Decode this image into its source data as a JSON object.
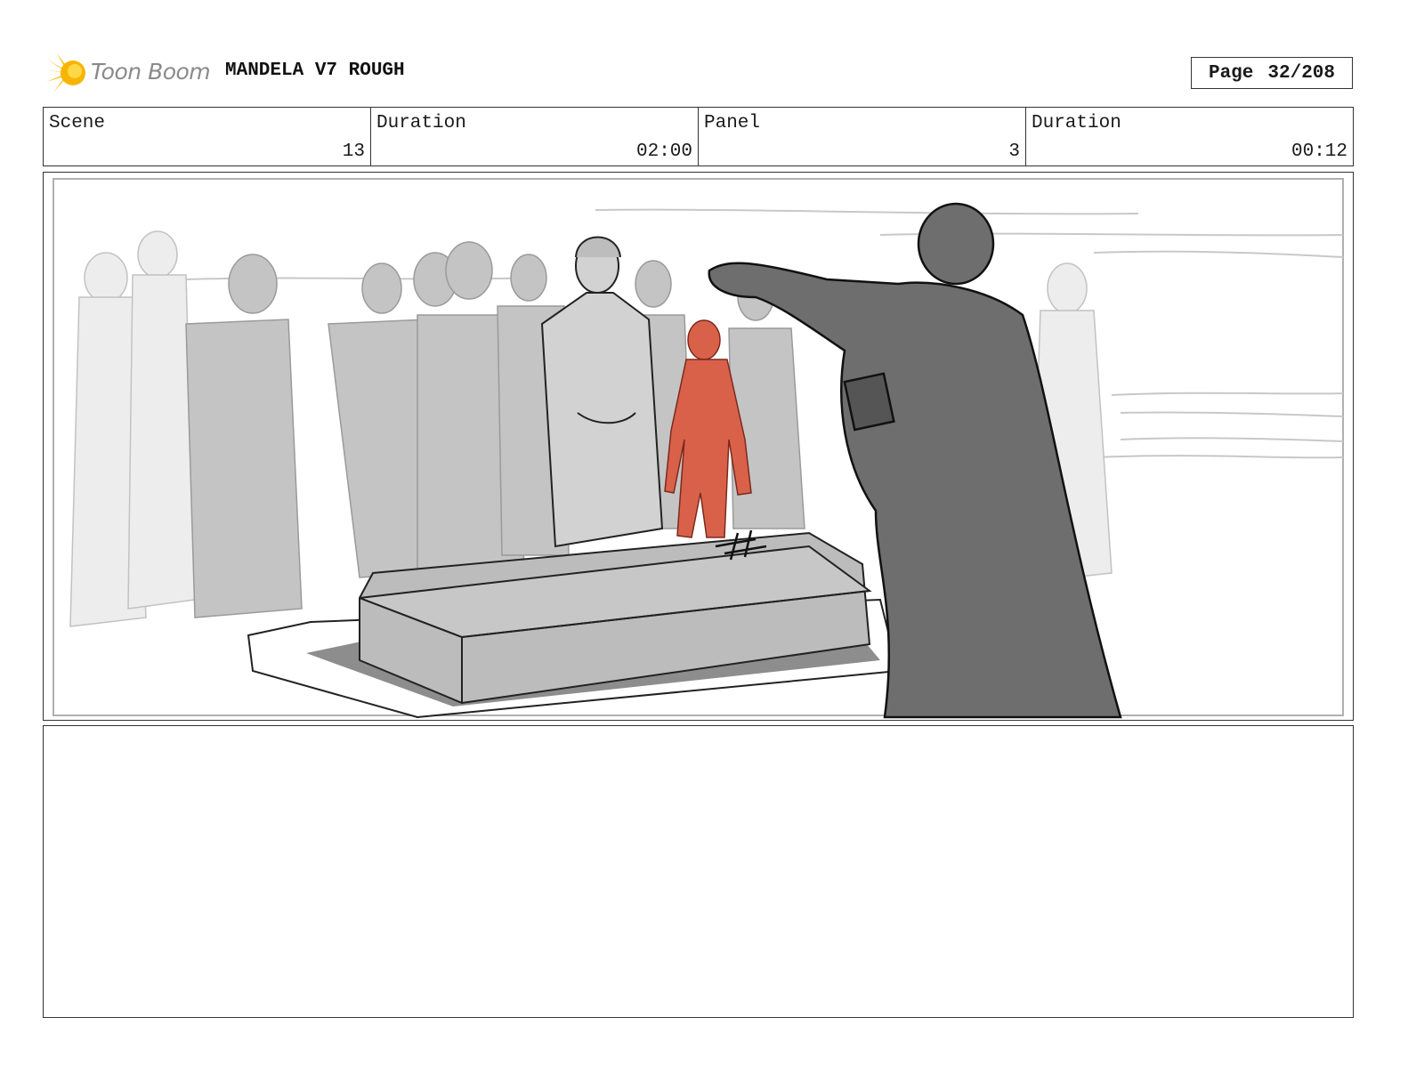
{
  "header": {
    "logo_text": "Toon Boom",
    "logo_icon": "sunburst-logo-icon",
    "project_title": "MANDELA V7 ROUGH",
    "page_label": "Page",
    "page_number": "32/208"
  },
  "info": {
    "scene_label": "Scene",
    "scene_value": "13",
    "scene_duration_label": "Duration",
    "scene_duration_value": "02:00",
    "panel_label": "Panel",
    "panel_value": "3",
    "panel_duration_label": "Duration",
    "panel_duration_value": "00:12"
  },
  "colors": {
    "highlight_figure": "#d9614a",
    "robed_figure": "#6e6e6e",
    "crowd": "#c4c4c4",
    "coffin": "#b7b7b7",
    "logo_yellow": "#f5c518"
  },
  "notes": {
    "text": ""
  }
}
